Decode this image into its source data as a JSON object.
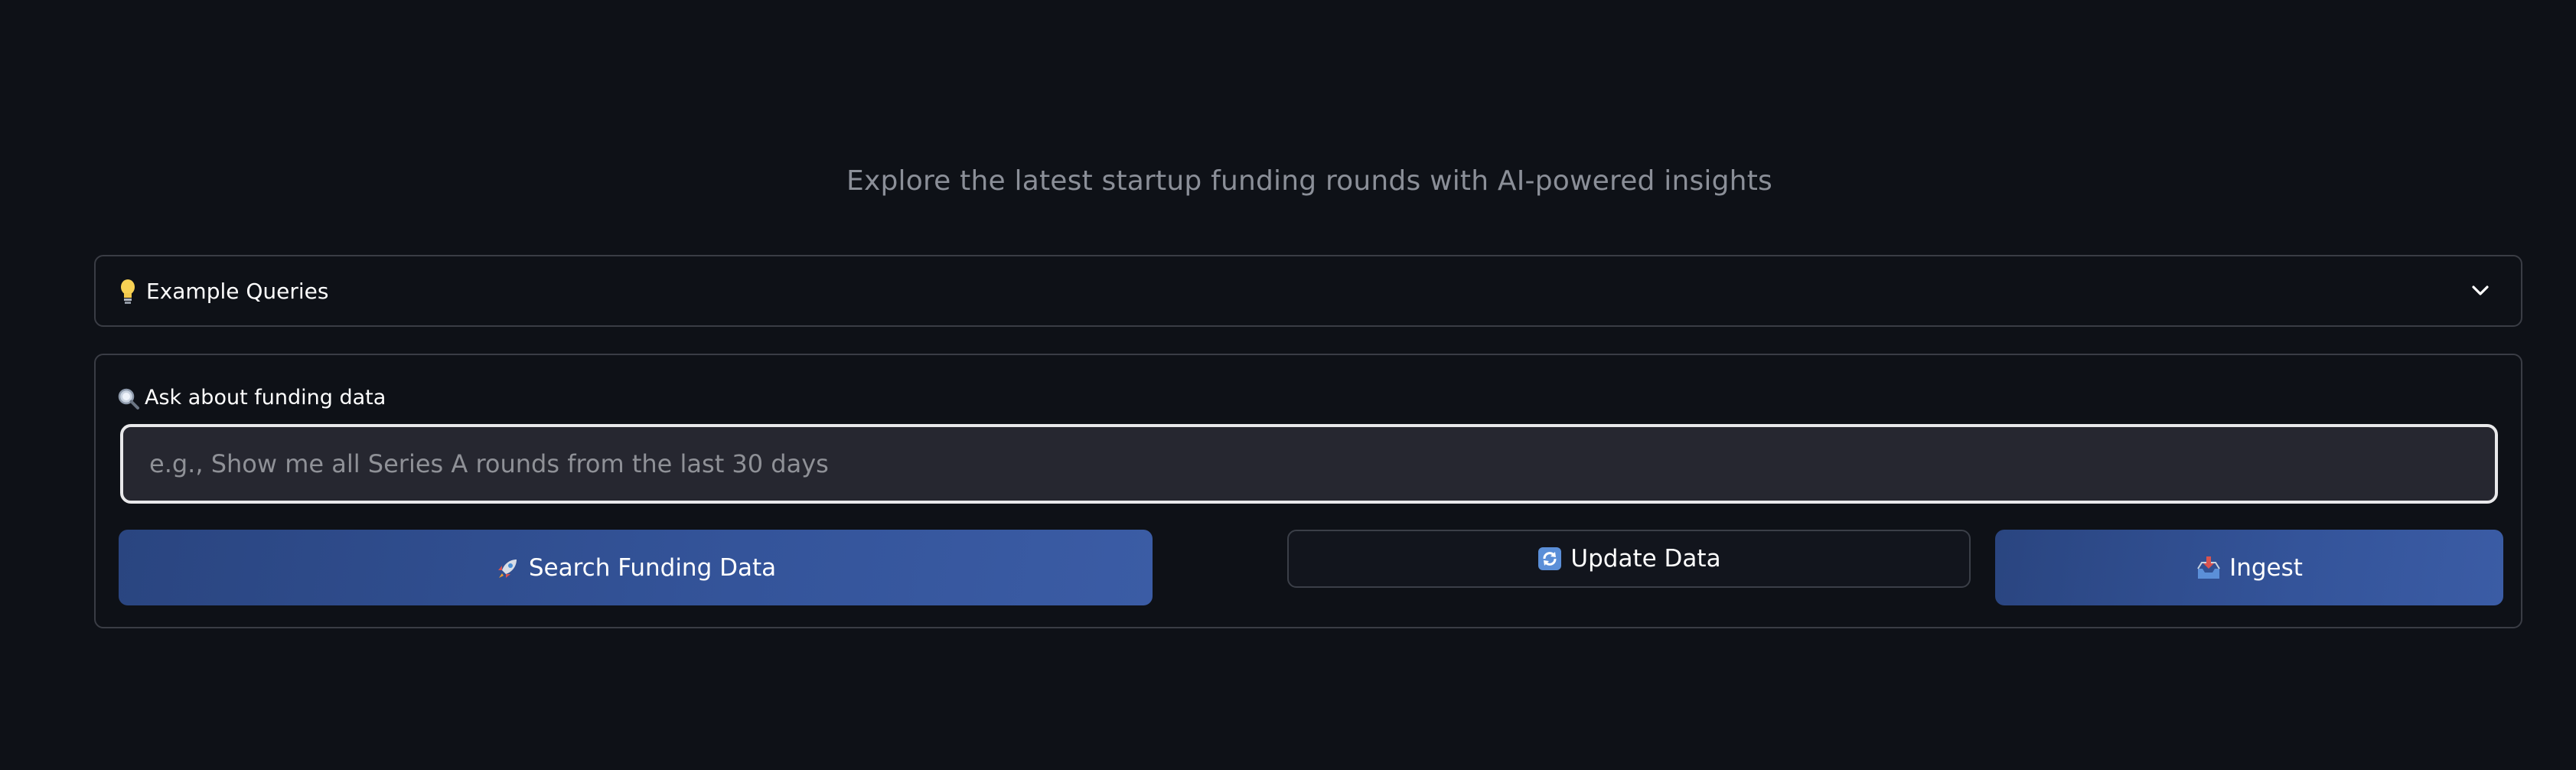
{
  "header": {
    "subtitle": "Explore the latest startup funding rounds with AI-powered insights"
  },
  "example_queries": {
    "icon": "lightbulb-icon",
    "label": "Example Queries",
    "chevron_icon": "chevron-down-icon",
    "expanded": false
  },
  "query_form": {
    "label_icon": "magnifier-icon",
    "label": "Ask about funding data",
    "input_value": "",
    "placeholder": "e.g., Show me all Series A rounds from the last 30 days"
  },
  "buttons": {
    "search": {
      "icon": "rocket-icon",
      "label": "Search Funding Data"
    },
    "update": {
      "icon": "refresh-icon",
      "label": "Update Data"
    },
    "ingest": {
      "icon": "inbox-tray-icon",
      "label": "Ingest"
    }
  },
  "colors": {
    "background": "#0e1117",
    "primary_button": "#34549a",
    "input_background": "#262730",
    "border": "#3a3d45"
  }
}
